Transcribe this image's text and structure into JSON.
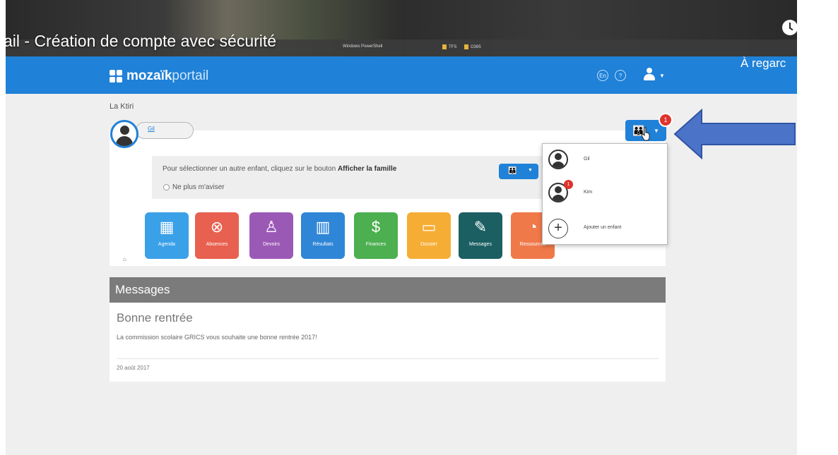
{
  "video": {
    "title": "ail - Création de compte avec sécurité",
    "watch_later": "À regarc",
    "bookmarks": [
      "Windows PowerShell",
      "TFS",
      "O365"
    ]
  },
  "app": {
    "logo_bold": "mozaïk",
    "logo_light": "portail",
    "header_icons": [
      "En",
      "?"
    ],
    "brand_color": "#1f81d8"
  },
  "parent": {
    "name": "La Ktiri"
  },
  "child": {
    "selected_name": "Gil"
  },
  "hint": {
    "text_before": "Pour sélectionner un autre enfant, cliquez sur le bouton ",
    "text_bold": "Afficher la famille",
    "checkbox_label": "Ne plus m'aviser"
  },
  "tiles": [
    {
      "label": "Agenda",
      "icon": "calendar-icon",
      "glyph": "▦",
      "color": "#3aa0e8"
    },
    {
      "label": "Absences",
      "icon": "absence-icon",
      "glyph": "⊗",
      "color": "#e8604f"
    },
    {
      "label": "Devoirs",
      "icon": "homework-icon",
      "glyph": "♙",
      "color": "#9b59b6"
    },
    {
      "label": "Résultats",
      "icon": "results-chart-icon",
      "glyph": "▥",
      "color": "#2f86d6"
    },
    {
      "label": "Finances",
      "icon": "finances-icon",
      "glyph": "$",
      "color": "#4caf50"
    },
    {
      "label": "Dossier",
      "icon": "folder-icon",
      "glyph": "▭",
      "color": "#f6ad35"
    },
    {
      "label": "Messages",
      "icon": "messages-icon",
      "glyph": "✎",
      "color": "#1b5f63"
    },
    {
      "label": "Ressources",
      "icon": "resources-icon",
      "glyph": "◔",
      "color": "#f0794a"
    }
  ],
  "family_button": {
    "badge": "1"
  },
  "dropdown": {
    "children": [
      {
        "name": "Gil",
        "badge": ""
      },
      {
        "name": "Kim",
        "badge": "1"
      }
    ],
    "add_label": "Ajouter un enfant"
  },
  "messages": {
    "header": "Messages",
    "title": "Bonne rentrée",
    "text": "La commission scolaire GRICS vous souhaite une bonne rentrée 2017!",
    "date": "20 août 2017"
  }
}
